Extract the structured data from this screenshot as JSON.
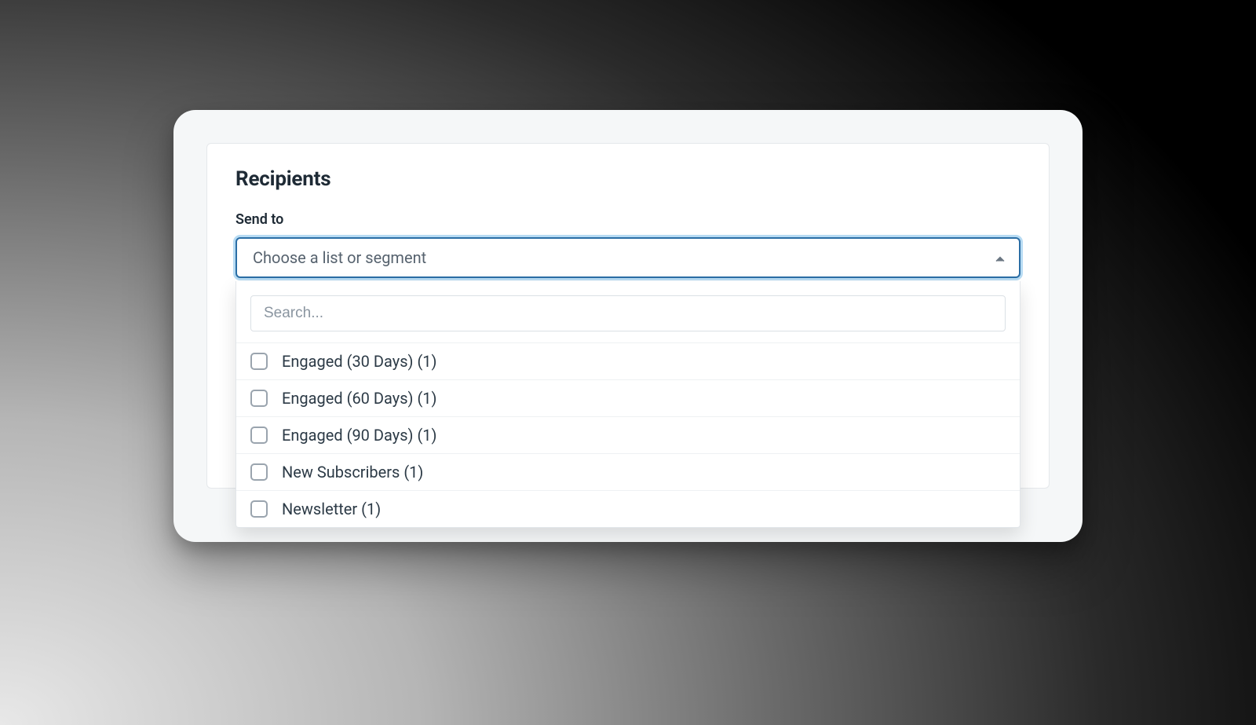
{
  "section": {
    "title": "Recipients",
    "field_label": "Send to"
  },
  "select": {
    "placeholder": "Choose a list or segment",
    "search_placeholder": "Search...",
    "options": [
      {
        "label": "Engaged (30 Days) (1)"
      },
      {
        "label": "Engaged (60 Days) (1)"
      },
      {
        "label": "Engaged (90 Days) (1)"
      },
      {
        "label": "New Subscribers (1)"
      },
      {
        "label": "Newsletter (1)"
      }
    ]
  }
}
